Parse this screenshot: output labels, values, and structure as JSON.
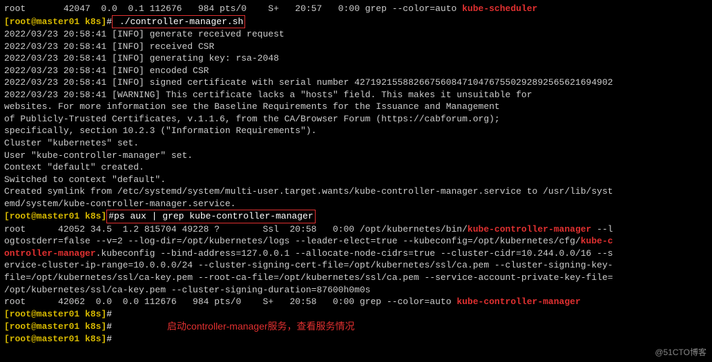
{
  "top_partial": "root       42047  0.0  0.1 112676   984 pts/0    S+   20:57   0:00 grep --color=auto",
  "top_partial_red": " kube-scheduler",
  "prompt1": {
    "user_host": "[root@master01 k8s]",
    "hash": "#",
    "cmd": " ./controller-manager.sh"
  },
  "log": [
    "2022/03/23 20:58:41 [INFO] generate received request",
    "2022/03/23 20:58:41 [INFO] received CSR",
    "2022/03/23 20:58:41 [INFO] generating key: rsa-2048",
    "2022/03/23 20:58:41 [INFO] encoded CSR",
    "2022/03/23 20:58:41 [INFO] signed certificate with serial number 427192155882667560847104767550292892565621694902",
    "2022/03/23 20:58:41 [WARNING] This certificate lacks a \"hosts\" field. This makes it unsuitable for",
    "websites. For more information see the Baseline Requirements for the Issuance and Management",
    "of Publicly-Trusted Certificates, v.1.1.6, from the CA/Browser Forum (https://cabforum.org);",
    "specifically, section 10.2.3 (\"Information Requirements\").",
    "Cluster \"kubernetes\" set.",
    "User \"kube-controller-manager\" set.",
    "Context \"default\" created.",
    "Switched to context \"default\".",
    "Created symlink from /etc/systemd/system/multi-user.target.wants/kube-controller-manager.service to /usr/lib/syst",
    "emd/system/kube-controller-manager.service."
  ],
  "prompt2": {
    "user_host": "[root@master01 k8s]",
    "hash": "#",
    "cmd": "ps aux | grep kube-controller-manager"
  },
  "ps1": {
    "pre": "root      42052 34.5  1.2 815704 49228 ?        Ssl  20:58   0:00 /opt/kubernetes/bin/",
    "hl1": "kube-controller-manager",
    "mid1": " --l\nogtostderr=false --v=2 --log-dir=/opt/kubernetes/logs --leader-elect=true --kubeconfig=/opt/kubernetes/cfg/",
    "hl2": "kube-c\nontroller-manager",
    "mid2": ".kubeconfig --bind-address=127.0.0.1 --allocate-node-cidrs=true --cluster-cidr=10.244.0.0/16 --s\nervice-cluster-ip-range=10.0.0.0/24 --cluster-signing-cert-file=/opt/kubernetes/ssl/ca.pem --cluster-signing-key-\nfile=/opt/kubernetes/ssl/ca-key.pem --root-ca-file=/opt/kubernetes/ssl/ca.pem --service-account-private-key-file=\n/opt/kubernetes/ssl/ca-key.pem --cluster-signing-duration=87600h0m0s"
  },
  "ps2": {
    "pre": "root      42062  0.0  0.0 112676   984 pts/0    S+   20:58   0:00 grep --color=auto ",
    "hl": "kube-controller-manager"
  },
  "prompt_empty": {
    "user_host": "[root@master01 k8s]",
    "hash": "#"
  },
  "annotation": "启动controller-manager服务，查看服务情况",
  "watermark": "@51CTO博客"
}
